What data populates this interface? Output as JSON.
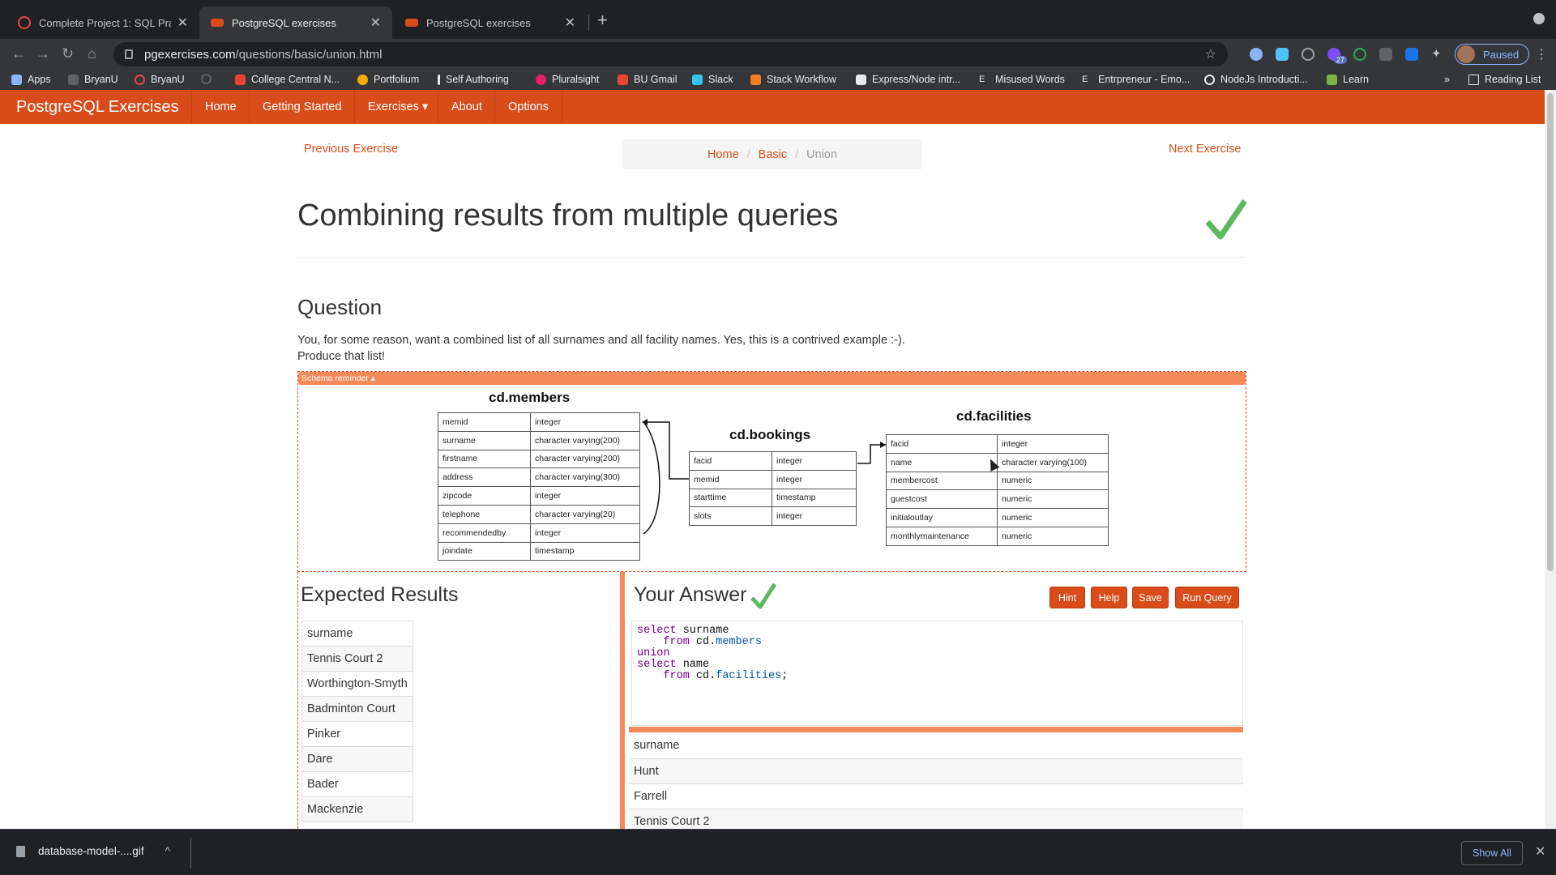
{
  "browser": {
    "tabs": [
      {
        "title": "Complete Project 1: SQL Practi",
        "active": false
      },
      {
        "title": "PostgreSQL exercises",
        "active": true
      },
      {
        "title": "PostgreSQL exercises",
        "active": false
      }
    ],
    "url_host": "pgexercises.com",
    "url_path": "/questions/basic/union.html",
    "profile_label": "Paused",
    "extension_badge": "27",
    "bookmarks": [
      "Apps",
      "BryanU",
      "BryanU",
      "College Central N...",
      "Portfolium",
      "Self Authoring",
      "Pluralsight",
      "BU Gmail",
      "Slack",
      "Stack Workflow",
      "Express/Node intr...",
      "Misused Words",
      "Entrpreneur - Emo...",
      "NodeJs Introducti...",
      "Learn"
    ],
    "bookmarks_overflow": "»",
    "reading_list": "Reading List"
  },
  "site": {
    "brand": "PostgreSQL Exercises",
    "nav": [
      "Home",
      "Getting Started",
      "Exercises",
      "About",
      "Options"
    ]
  },
  "pager": {
    "previous": "Previous Exercise",
    "next": "Next Exercise",
    "breadcrumb": [
      "Home",
      "Basic",
      "Union"
    ]
  },
  "page": {
    "title": "Combining results from multiple queries",
    "question_heading": "Question",
    "question_line1": "You, for some reason, want a combined list of all surnames and all facility names. Yes, this is a contrived example :-).",
    "question_line2": "Produce that list!"
  },
  "schema": {
    "toggle_label": "Schema reminder ▴",
    "tables": [
      {
        "name": "cd.members",
        "columns": [
          [
            "memid",
            "integer"
          ],
          [
            "surname",
            "character varying(200)"
          ],
          [
            "firstname",
            "character varying(200)"
          ],
          [
            "address",
            "character varying(300)"
          ],
          [
            "zipcode",
            "integer"
          ],
          [
            "telephone",
            "character varying(20)"
          ],
          [
            "recommendedby",
            "integer"
          ],
          [
            "joindate",
            "timestamp"
          ]
        ]
      },
      {
        "name": "cd.bookings",
        "columns": [
          [
            "facid",
            "integer"
          ],
          [
            "memid",
            "integer"
          ],
          [
            "starttime",
            "timestamp"
          ],
          [
            "slots",
            "integer"
          ]
        ]
      },
      {
        "name": "cd.facilities",
        "columns": [
          [
            "facid",
            "integer"
          ],
          [
            "name",
            "character varying(100)"
          ],
          [
            "membercost",
            "numeric"
          ],
          [
            "guestcost",
            "numeric"
          ],
          [
            "initialoutlay",
            "numeric"
          ],
          [
            "monthlymaintenance",
            "numeric"
          ]
        ]
      }
    ]
  },
  "expected": {
    "heading": "Expected Results",
    "rows": [
      "surname",
      "Tennis Court 2",
      "Worthington-Smyth",
      "Badminton Court",
      "Pinker",
      "Dare",
      "Bader",
      "Mackenzie"
    ]
  },
  "answer": {
    "heading": "Your Answer",
    "buttons": [
      "Hint",
      "Help",
      "Save",
      "Run Query"
    ],
    "code_lines": [
      [
        "select",
        " surname"
      ],
      [
        "    from",
        " cd.",
        "members",
        ""
      ],
      [
        "union",
        ""
      ],
      [
        "select",
        " name"
      ],
      [
        "    from",
        " cd.",
        "facilities",
        ";"
      ]
    ],
    "result_rows": [
      "surname",
      "Hunt",
      "Farrell",
      "Tennis Court 2"
    ]
  },
  "downloads": {
    "filename": "database-model-....gif",
    "show_all": "Show All"
  },
  "colors": {
    "accent": "#d94c19",
    "accent_light": "#f48a5a",
    "success": "#5cb85c"
  }
}
